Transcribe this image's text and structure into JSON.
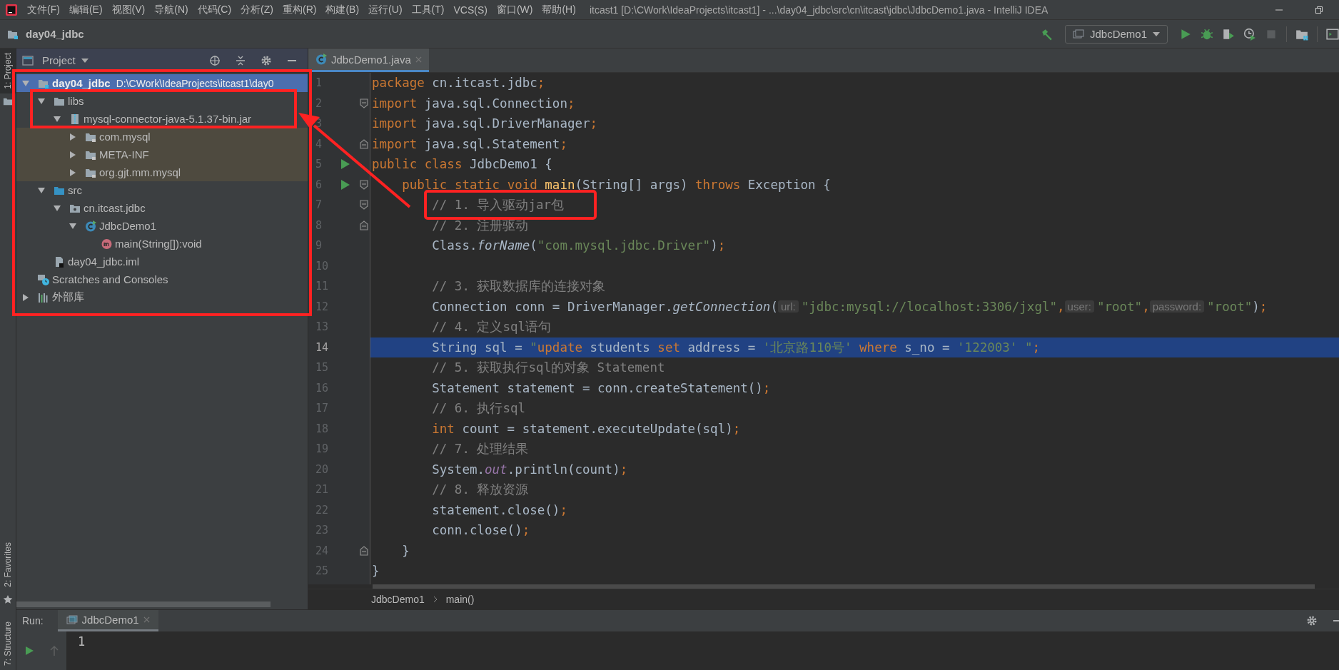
{
  "window": {
    "title": "itcast1 [D:\\CWork\\IdeaProjects\\itcast1] - ...\\day04_jdbc\\src\\cn\\itcast\\jdbc\\JdbcDemo1.java - IntelliJ IDEA"
  },
  "menu": [
    "文件(F)",
    "编辑(E)",
    "视图(V)",
    "导航(N)",
    "代码(C)",
    "分析(Z)",
    "重构(R)",
    "构建(B)",
    "运行(U)",
    "工具(T)",
    "VCS(S)",
    "窗口(W)",
    "帮助(H)"
  ],
  "navbar": {
    "project": "day04_jdbc",
    "run_config": "JdbcDemo1"
  },
  "left_stripe": {
    "top": [
      {
        "label": "1: Project",
        "selected": true
      }
    ],
    "bottom": [
      {
        "label": "2: Favorites",
        "selected": false
      },
      {
        "label": "7: Structure",
        "selected": false
      }
    ]
  },
  "project_panel": {
    "title": "Project"
  },
  "tree": {
    "items": [
      {
        "kind": "module",
        "label": "day04_jdbc",
        "detail": "D:\\CWork\\IdeaProjects\\itcast1\\day0",
        "expanded": true,
        "selected": true,
        "children": [
          {
            "kind": "folder",
            "label": "libs",
            "expanded": true,
            "selected": false,
            "children": [
              {
                "kind": "jar",
                "label": "mysql-connector-java-5.1.37-bin.jar",
                "expanded": true,
                "selected": false,
                "children": [
                  {
                    "kind": "locked-folder",
                    "label": "com.mysql",
                    "expanded": false,
                    "selected": false,
                    "shaded": true
                  },
                  {
                    "kind": "locked-folder",
                    "label": "META-INF",
                    "expanded": false,
                    "selected": false,
                    "shaded": true
                  },
                  {
                    "kind": "locked-folder",
                    "label": "org.gjt.mm.mysql",
                    "expanded": false,
                    "selected": false,
                    "shaded": true
                  }
                ]
              }
            ]
          },
          {
            "kind": "source-folder",
            "label": "src",
            "expanded": true,
            "selected": false,
            "children": [
              {
                "kind": "package",
                "label": "cn.itcast.jdbc",
                "expanded": true,
                "selected": false,
                "children": [
                  {
                    "kind": "class",
                    "label": "JdbcDemo1",
                    "expanded": true,
                    "selected": false,
                    "children": [
                      {
                        "kind": "method",
                        "label": "main(String[]):void",
                        "selected": false
                      }
                    ]
                  }
                ]
              }
            ]
          },
          {
            "kind": "iml",
            "label": "day04_jdbc.iml",
            "selected": false
          }
        ]
      },
      {
        "kind": "scratches",
        "label": "Scratches and Consoles",
        "selected": false
      },
      {
        "kind": "library",
        "label": "外部库",
        "expanded": false,
        "selected": false
      }
    ]
  },
  "editor": {
    "tabs": [
      {
        "label": "JdbcDemo1.java",
        "selected": true
      }
    ]
  },
  "code": {
    "lines": [
      {
        "n": "1",
        "selected": false,
        "tokens": [
          {
            "kind": "keyword",
            "text": "package"
          },
          {
            "kind": "plain",
            "text": " cn.itcast.jdbc"
          },
          {
            "kind": "punct",
            "text": ";"
          }
        ]
      },
      {
        "n": "2",
        "selected": false,
        "markers": [
          {
            "kind": "fold-start"
          }
        ],
        "tokens": [
          {
            "kind": "keyword",
            "text": "import"
          },
          {
            "kind": "plain",
            "text": " java.sql.Connection"
          },
          {
            "kind": "punct",
            "text": ";"
          }
        ]
      },
      {
        "n": "3",
        "selected": false,
        "tokens": [
          {
            "kind": "keyword",
            "text": "import"
          },
          {
            "kind": "plain",
            "text": " java.sql.DriverManager"
          },
          {
            "kind": "punct",
            "text": ";"
          }
        ]
      },
      {
        "n": "4",
        "selected": false,
        "markers": [
          {
            "kind": "fold-end"
          }
        ],
        "tokens": [
          {
            "kind": "keyword",
            "text": "import"
          },
          {
            "kind": "plain",
            "text": " java.sql.Statement"
          },
          {
            "kind": "punct",
            "text": ";"
          }
        ]
      },
      {
        "n": "5",
        "selected": false,
        "markers": [
          {
            "kind": "run"
          }
        ],
        "tokens": [
          {
            "kind": "keyword",
            "text": "public class"
          },
          {
            "kind": "plain",
            "text": " JdbcDemo1 {"
          }
        ]
      },
      {
        "n": "6",
        "selected": false,
        "markers": [
          {
            "kind": "run"
          },
          {
            "kind": "fold-start"
          }
        ],
        "tokens": [
          {
            "kind": "keyword",
            "text": "    public static void "
          },
          {
            "kind": "decl",
            "text": "main"
          },
          {
            "kind": "plain",
            "text": "(String[] args) "
          },
          {
            "kind": "keyword",
            "text": "throws"
          },
          {
            "kind": "plain",
            "text": " Exception {"
          }
        ]
      },
      {
        "n": "7",
        "selected": false,
        "markers": [
          {
            "kind": "fold-start"
          }
        ],
        "tokens": [
          {
            "kind": "comment",
            "text": "        // 1. 导入驱动jar包"
          }
        ]
      },
      {
        "n": "8",
        "selected": false,
        "markers": [
          {
            "kind": "fold-end"
          }
        ],
        "tokens": [
          {
            "kind": "comment",
            "text": "        // 2. 注册驱动"
          }
        ]
      },
      {
        "n": "9",
        "selected": false,
        "tokens": [
          {
            "kind": "plain",
            "text": "        Class."
          },
          {
            "kind": "method",
            "text": "forName"
          },
          {
            "kind": "plain",
            "text": "("
          },
          {
            "kind": "string",
            "text": "\"com.mysql.jdbc.Driver\""
          },
          {
            "kind": "plain",
            "text": ")"
          },
          {
            "kind": "punct",
            "text": ";"
          }
        ]
      },
      {
        "n": "10",
        "selected": false
      },
      {
        "n": "11",
        "selected": false,
        "tokens": [
          {
            "kind": "comment",
            "text": "        // 3. 获取数据库的连接对象"
          }
        ]
      },
      {
        "n": "12",
        "selected": false,
        "tokens": [
          {
            "kind": "plain",
            "text": "        Connection conn = DriverManager."
          },
          {
            "kind": "method",
            "text": "getConnection"
          },
          {
            "kind": "plain",
            "text": "("
          },
          {
            "kind": "hint",
            "text": "url:"
          },
          {
            "kind": "string",
            "text": "\"jdbc:mysql://localhost:3306/jxgl\""
          },
          {
            "kind": "punct",
            "text": ","
          },
          {
            "kind": "hint",
            "text": "user:"
          },
          {
            "kind": "string",
            "text": "\"root\""
          },
          {
            "kind": "punct",
            "text": ","
          },
          {
            "kind": "hint",
            "text": "password:"
          },
          {
            "kind": "string",
            "text": "\"root\""
          },
          {
            "kind": "plain",
            "text": ")"
          },
          {
            "kind": "punct",
            "text": ";"
          }
        ]
      },
      {
        "n": "13",
        "selected": false,
        "tokens": [
          {
            "kind": "comment",
            "text": "        // 4. 定义sql语句"
          }
        ]
      },
      {
        "n": "14",
        "selected": true,
        "tokens": [
          {
            "kind": "plain",
            "text": "        String sql = "
          },
          {
            "kind": "string",
            "text": "\""
          },
          {
            "kind": "keyword",
            "text": "update"
          },
          {
            "kind": "plain",
            "text": " students "
          },
          {
            "kind": "keyword",
            "text": "set"
          },
          {
            "kind": "plain",
            "text": " address = "
          },
          {
            "kind": "string",
            "text": "'北京路110号'"
          },
          {
            "kind": "keyword",
            "text": " where"
          },
          {
            "kind": "plain",
            "text": " s_no = "
          },
          {
            "kind": "string",
            "text": "'122003' \""
          },
          {
            "kind": "punct",
            "text": ";"
          }
        ]
      },
      {
        "n": "15",
        "selected": false,
        "tokens": [
          {
            "kind": "comment",
            "text": "        // 5. 获取执行sql的对象 Statement"
          }
        ]
      },
      {
        "n": "16",
        "selected": false,
        "tokens": [
          {
            "kind": "plain",
            "text": "        Statement statement = conn.createStatement()"
          },
          {
            "kind": "punct",
            "text": ";"
          }
        ]
      },
      {
        "n": "17",
        "selected": false,
        "tokens": [
          {
            "kind": "comment",
            "text": "        // 6. 执行sql"
          }
        ]
      },
      {
        "n": "18",
        "selected": false,
        "tokens": [
          {
            "kind": "keyword",
            "text": "        int"
          },
          {
            "kind": "plain",
            "text": " count = statement.executeUpdate(sql)"
          },
          {
            "kind": "punct",
            "text": ";"
          }
        ]
      },
      {
        "n": "19",
        "selected": false,
        "tokens": [
          {
            "kind": "comment",
            "text": "        // 7. 处理结果"
          }
        ]
      },
      {
        "n": "20",
        "selected": false,
        "tokens": [
          {
            "kind": "plain",
            "text": "        System."
          },
          {
            "kind": "field",
            "text": "out"
          },
          {
            "kind": "plain",
            "text": ".println(count)"
          },
          {
            "kind": "punct",
            "text": ";"
          }
        ]
      },
      {
        "n": "21",
        "selected": false,
        "tokens": [
          {
            "kind": "comment",
            "text": "        // 8. 释放资源"
          }
        ]
      },
      {
        "n": "22",
        "selected": false,
        "tokens": [
          {
            "kind": "plain",
            "text": "        statement.close()"
          },
          {
            "kind": "punct",
            "text": ";"
          }
        ]
      },
      {
        "n": "23",
        "selected": false,
        "tokens": [
          {
            "kind": "plain",
            "text": "        conn.close()"
          },
          {
            "kind": "punct",
            "text": ";"
          }
        ]
      },
      {
        "n": "24",
        "selected": false,
        "markers": [
          {
            "kind": "fold-end"
          }
        ],
        "tokens": [
          {
            "kind": "plain",
            "text": "    }"
          }
        ]
      },
      {
        "n": "25",
        "selected": false,
        "tokens": [
          {
            "kind": "plain",
            "text": "}"
          }
        ]
      }
    ]
  },
  "breadcrumb": [
    "JdbcDemo1",
    "main()"
  ],
  "run_panel": {
    "label": "Run:",
    "tabs": [
      {
        "label": "JdbcDemo1",
        "selected": true
      }
    ],
    "output": "1"
  }
}
